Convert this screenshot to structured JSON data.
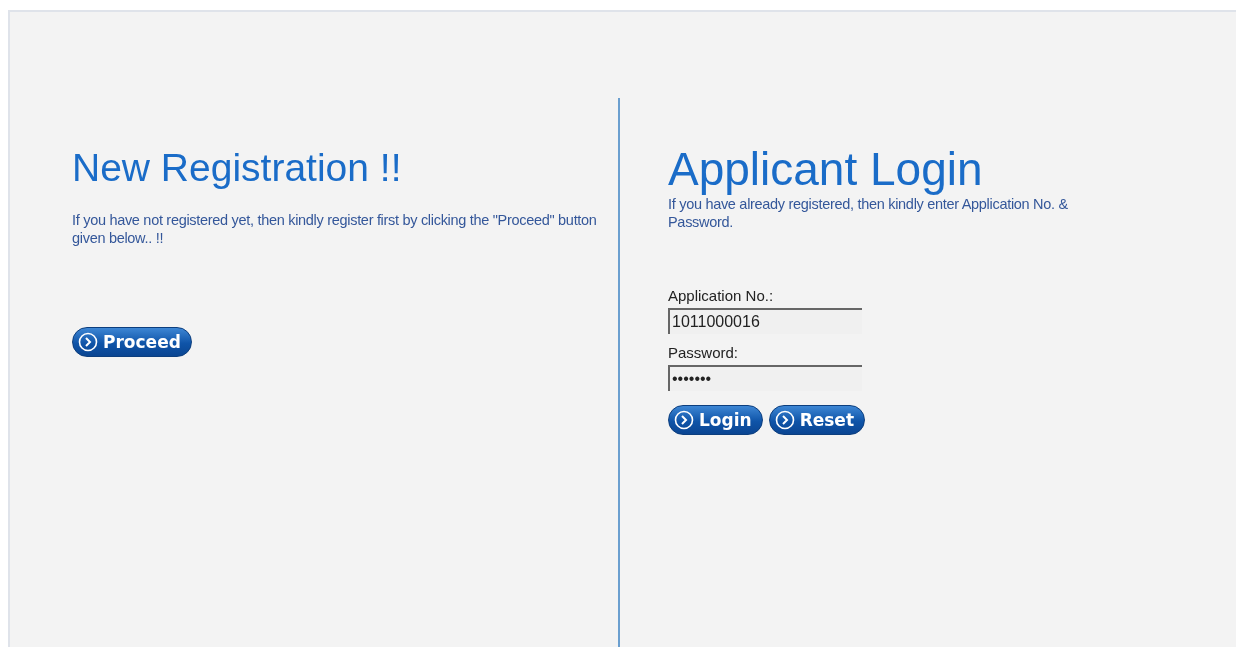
{
  "registration": {
    "title": "New Registration !!",
    "text": "If you have not registered yet, then kindly register first by clicking the \"Proceed\" button given below.. !!",
    "button": "Proceed"
  },
  "login": {
    "title": "Applicant Login",
    "text": "If you have already registered, then kindly enter Application No. & Password.",
    "fields": [
      {
        "label": "Application No.:",
        "value": "1011000016"
      },
      {
        "label": "Password:",
        "value": "•••••••"
      }
    ],
    "buttons": [
      "Login",
      "Reset"
    ]
  }
}
